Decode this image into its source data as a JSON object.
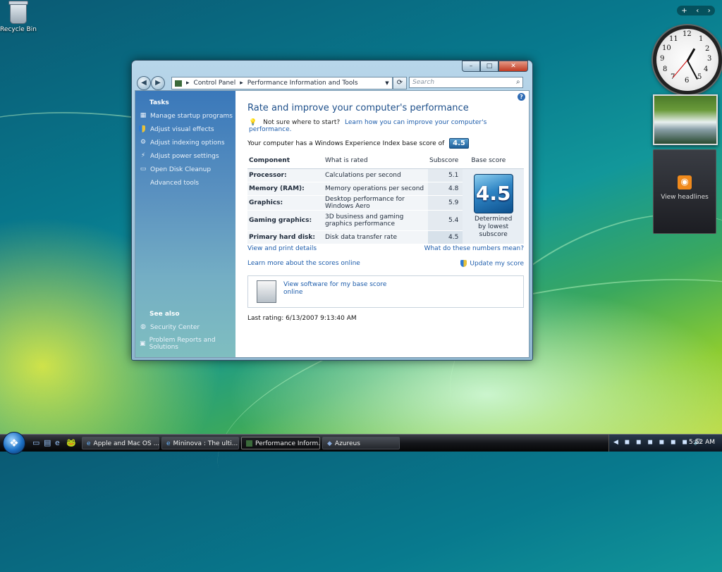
{
  "desktop": {
    "icons": [
      {
        "label": "Recycle Bin",
        "icon": "recycle-bin-icon"
      }
    ]
  },
  "sidebar": {
    "controls": [
      "+",
      "‹",
      "›"
    ],
    "clock": {
      "numbers": [
        "12",
        "1",
        "2",
        "3",
        "4",
        "5",
        "6",
        "7",
        "8",
        "9",
        "10",
        "11"
      ]
    },
    "headlines": {
      "label": "View headlines",
      "icon": "rss-icon"
    }
  },
  "window": {
    "caption": {
      "minimize": "–",
      "maximize": "□",
      "close": "✕"
    },
    "nav": {
      "back": "◀",
      "forward": "▶"
    },
    "address": {
      "root_icon": "control-panel-icon",
      "segments": [
        "Control Panel",
        "Performance Information and Tools"
      ]
    },
    "search": {
      "placeholder": "Search"
    },
    "tasks": {
      "heading": "Tasks",
      "items": [
        {
          "label": "Manage startup programs",
          "icon": "startup-icon"
        },
        {
          "label": "Adjust visual effects",
          "icon": "shield-icon"
        },
        {
          "label": "Adjust indexing options",
          "icon": "indexing-icon"
        },
        {
          "label": "Adjust power settings",
          "icon": "power-icon"
        },
        {
          "label": "Open Disk Cleanup",
          "icon": "disk-cleanup-icon"
        },
        {
          "label": "Advanced tools",
          "icon": "tools-icon"
        }
      ],
      "see_also_heading": "See also",
      "see_also": [
        {
          "label": "Security Center",
          "icon": "security-center-icon"
        },
        {
          "label": "Problem Reports and Solutions",
          "icon": "problem-reports-icon"
        }
      ]
    },
    "content": {
      "title": "Rate and improve your computer's performance",
      "not_sure": "Not sure where to start?",
      "learn_link": "Learn how you can improve your computer's performance.",
      "base_score_text": "Your computer has a Windows Experience Index base score of",
      "base_score": "4.5",
      "table": {
        "headers": {
          "component": "Component",
          "rated": "What is rated",
          "subscore": "Subscore",
          "base": "Base score"
        },
        "rows": [
          {
            "component": "Processor:",
            "rated": "Calculations per second",
            "subscore": "5.1"
          },
          {
            "component": "Memory (RAM):",
            "rated": "Memory operations per second",
            "subscore": "4.8"
          },
          {
            "component": "Graphics:",
            "rated": "Desktop performance for Windows Aero",
            "subscore": "5.9"
          },
          {
            "component": "Gaming graphics:",
            "rated": "3D business and gaming graphics performance",
            "subscore": "5.4"
          },
          {
            "component": "Primary hard disk:",
            "rated": "Disk data transfer rate",
            "subscore": "4.5"
          }
        ],
        "determined_by": "Determined by lowest subscore"
      },
      "view_print": "View and print details",
      "what_mean": "What do these numbers mean?",
      "learn_online": "Learn more about the scores online",
      "update_score": "Update my score",
      "software_link": "View software for my base score online",
      "last_rating": "Last rating: 6/13/2007 9:13:40 AM"
    }
  },
  "taskbar": {
    "start_icon": "windows-start-icon",
    "quick_launch": [
      "show-desktop-icon",
      "switch-windows-icon",
      "internet-explorer-icon",
      "azureus-icon"
    ],
    "buttons": [
      {
        "label": "Apple and Mac OS ...",
        "icon": "internet-explorer-icon",
        "active": false
      },
      {
        "label": "Mininova : The ulti...",
        "icon": "internet-explorer-icon",
        "active": false
      },
      {
        "label": "Performance Inform...",
        "icon": "control-panel-icon",
        "active": true
      },
      {
        "label": "Azureus",
        "icon": "azureus-icon",
        "active": false
      }
    ],
    "tray": {
      "time": "5:52 AM"
    }
  }
}
